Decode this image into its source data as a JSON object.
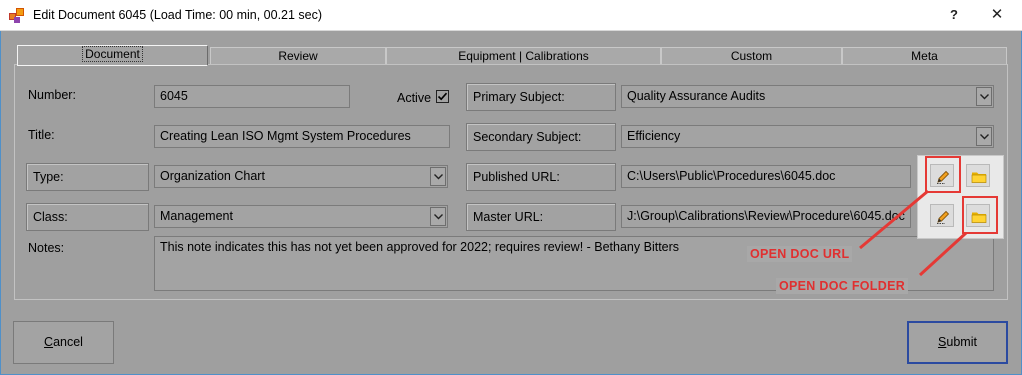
{
  "window": {
    "title": "Edit Document 6045 (Load Time: 00 min, 00.21 sec)",
    "help_label": "?",
    "close_label": "✕"
  },
  "tabs": [
    {
      "label": "Document",
      "active": true
    },
    {
      "label": "Review"
    },
    {
      "label": "Equipment | Calibrations"
    },
    {
      "label": "Custom"
    },
    {
      "label": "Meta"
    }
  ],
  "form": {
    "number_label": "Number:",
    "number_value": "6045",
    "active_label": "Active",
    "active_checked": true,
    "title_label": "Title:",
    "title_value": "Creating Lean ISO Mgmt System Procedures",
    "type_label": "Type:",
    "type_value": "Organization Chart",
    "class_label": "Class:",
    "class_value": "Management",
    "notes_label": "Notes:",
    "notes_value": "This note indicates this has not yet been approved for 2022; requires review! - Bethany Bitters",
    "primary_subject_label": "Primary Subject:",
    "primary_subject_value": "Quality Assurance Audits",
    "secondary_subject_label": "Secondary Subject:",
    "secondary_subject_value": "Efficiency",
    "published_url_label": "Published URL:",
    "published_url_value": "C:\\Users\\Public\\Procedures\\6045.doc",
    "master_url_label": "Master URL:",
    "master_url_value": "J:\\Group\\Calibrations\\Review\\Procedure\\6045.doc"
  },
  "annotations": {
    "open_doc_url": "OPEN DOC URL",
    "open_doc_folder": "OPEN DOC FOLDER",
    "color": "#e53935"
  },
  "buttons": {
    "cancel_prefix": "",
    "cancel_accel": "C",
    "cancel_rest": "ancel",
    "submit_accel": "S",
    "submit_rest": "ubmit"
  },
  "icons": {
    "app": "app-window-icon",
    "edit": "pencil-icon",
    "folder": "folder-icon"
  },
  "colors": {
    "accent_border": "#2b4aa0",
    "window_border": "#4f90c9",
    "folder": "#f2c200"
  }
}
